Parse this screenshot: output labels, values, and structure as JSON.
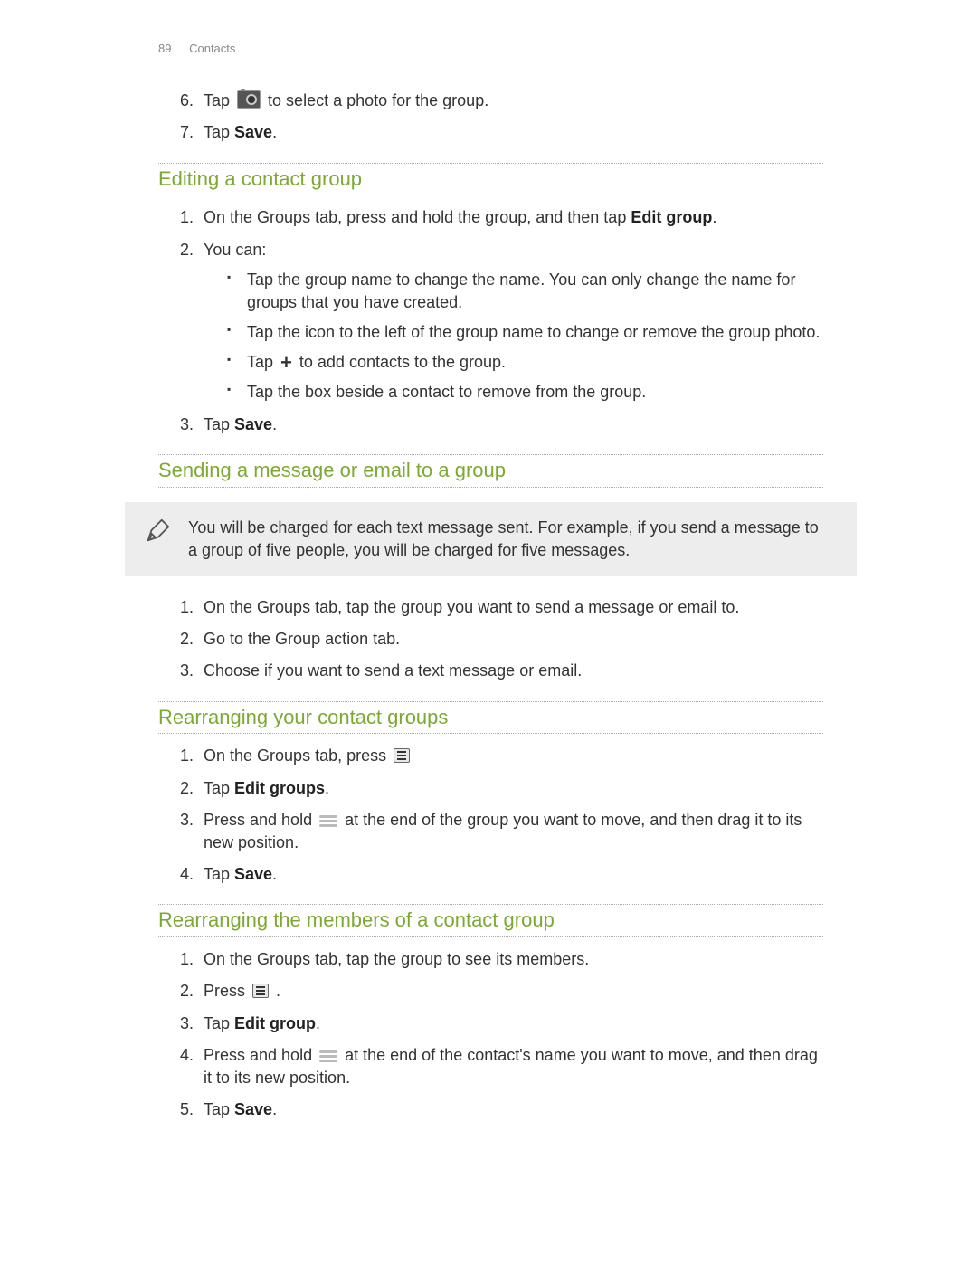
{
  "header": {
    "page_num": "89",
    "section": "Contacts"
  },
  "top_steps": {
    "six": {
      "num": "6.",
      "pre": "Tap ",
      "post": " to select a photo for the group."
    },
    "seven": {
      "num": "7.",
      "pre": "Tap ",
      "bold": "Save",
      "post": "."
    }
  },
  "sec_edit": {
    "title": "Editing a contact group",
    "step1": {
      "pre": "On the Groups tab, press and hold the group, and then tap ",
      "bold": "Edit group",
      "post": "."
    },
    "step2": "You can:",
    "bullets": {
      "b1": "Tap the group name to change the name. You can only change the name for groups that you have created.",
      "b2": "Tap the icon to the left of the group name to change or remove the group photo.",
      "b3_pre": "Tap ",
      "b3_post": " to add contacts to the group.",
      "b4": "Tap the box beside a contact to remove from the group."
    },
    "step3": {
      "pre": "Tap ",
      "bold": "Save",
      "post": "."
    }
  },
  "sec_send": {
    "title": "Sending a message or email to a group",
    "note": "You will be charged for each text message sent. For example, if you send a message to a group of five people, you will be charged for five messages.",
    "step1": "On the Groups tab, tap the group you want to send a message or email to.",
    "step2": "Go to the Group action tab.",
    "step3": "Choose if you want to send a text message or email."
  },
  "sec_rearrange_groups": {
    "title": "Rearranging your contact groups",
    "step1_pre": "On the Groups tab, press ",
    "step2_pre": "Tap ",
    "step2_bold": "Edit groups",
    "step2_post": ".",
    "step3_pre": "Press and hold ",
    "step3_post": " at the end of the group you want to move, and then drag it to its new position.",
    "step4_pre": "Tap ",
    "step4_bold": "Save",
    "step4_post": "."
  },
  "sec_rearrange_members": {
    "title": "Rearranging the members of a contact group",
    "step1": "On the Groups tab, tap the group to see its members.",
    "step2_pre": "Press ",
    "step2_post": " .",
    "step3_pre": "Tap ",
    "step3_bold": "Edit group",
    "step3_post": ".",
    "step4_pre": "Press and hold ",
    "step4_post": " at the end of the contact's name you want to move, and then drag it to its new position.",
    "step5_pre": "Tap ",
    "step5_bold": "Save",
    "step5_post": "."
  }
}
